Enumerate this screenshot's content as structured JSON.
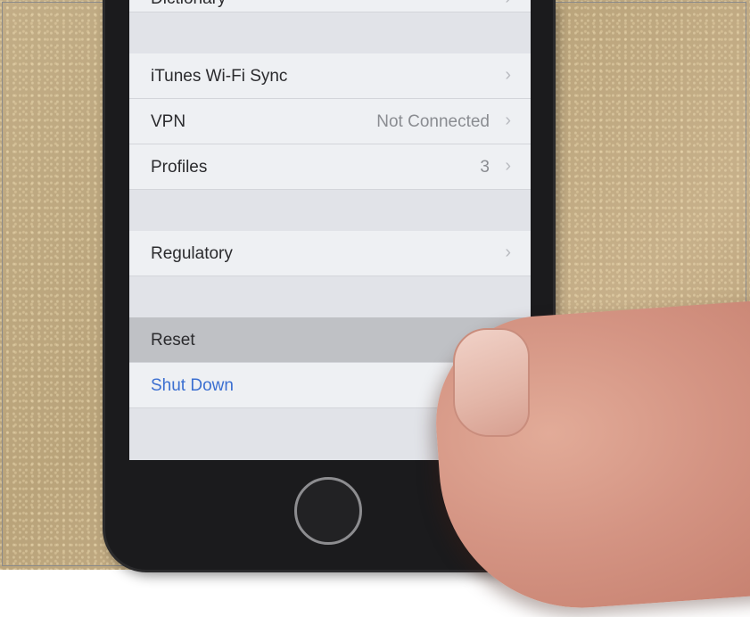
{
  "settings": {
    "rows": [
      {
        "label": "Dictionary",
        "value": ""
      },
      {
        "label": "iTunes Wi-Fi Sync",
        "value": ""
      },
      {
        "label": "VPN",
        "value": "Not Connected"
      },
      {
        "label": "Profiles",
        "value": "3"
      },
      {
        "label": "Regulatory",
        "value": ""
      },
      {
        "label": "Reset",
        "value": ""
      },
      {
        "label": "Shut Down",
        "value": ""
      }
    ],
    "chevron": "chevron-right-icon"
  },
  "colors": {
    "link_blue": "#3b6fd1",
    "row_background": "#eef0f3",
    "pressed_row": "#bfc1c5"
  }
}
